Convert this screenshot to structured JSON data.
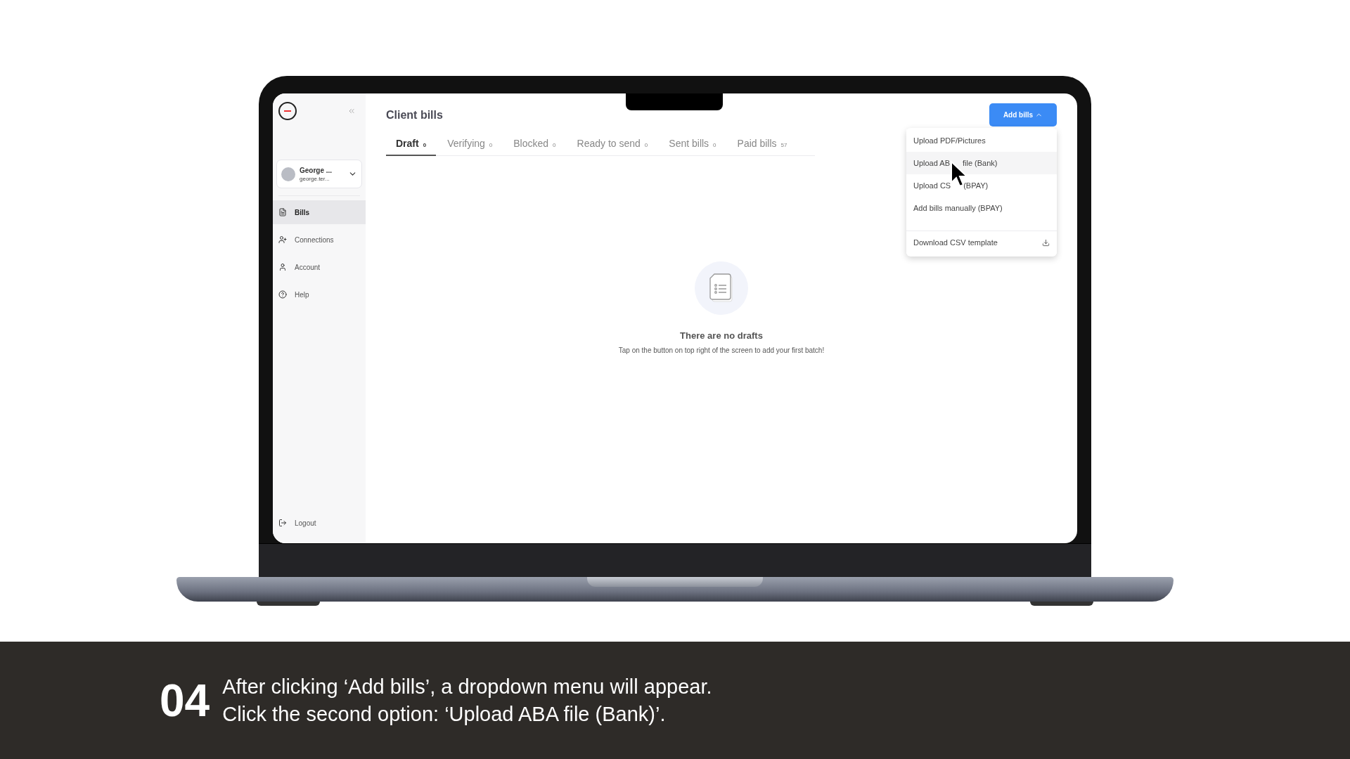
{
  "app": {
    "sidebar": {
      "user": {
        "name": "George ...",
        "email": "george.ter..."
      },
      "items": [
        {
          "label": "Bills",
          "selected": true
        },
        {
          "label": "Connections",
          "selected": false
        },
        {
          "label": "Account",
          "selected": false
        },
        {
          "label": "Help",
          "selected": false
        }
      ],
      "footer_item": {
        "label": "Logout"
      }
    },
    "header": {
      "title": "Client bills",
      "add_button": {
        "label": "Add bills",
        "expanded": true
      }
    },
    "tabs": [
      {
        "label": "Draft",
        "count": "0",
        "selected": true
      },
      {
        "label": "Verifying",
        "count": "0",
        "selected": false
      },
      {
        "label": "Blocked",
        "count": "0",
        "selected": false
      },
      {
        "label": "Ready to send",
        "count": "0",
        "selected": false
      },
      {
        "label": "Sent bills",
        "count": "0",
        "selected": false
      },
      {
        "label": "Paid bills",
        "count": "57",
        "selected": false
      }
    ],
    "menu": [
      {
        "kind": "option",
        "parts": [
          "Upload PDF/Pictures"
        ],
        "highlighted": false
      },
      {
        "kind": "option",
        "parts": [
          "Upload AB",
          "file (Bank)"
        ],
        "highlighted": true
      },
      {
        "kind": "option",
        "parts": [
          "Upload CS",
          "(BPAY)"
        ],
        "highlighted": false
      },
      {
        "kind": "option",
        "parts": [
          "Add bills manually (BPAY)"
        ],
        "highlighted": false
      },
      {
        "kind": "download",
        "parts": [
          "Download CSV template"
        ],
        "highlighted": false
      }
    ],
    "empty_state": {
      "title": "There are no drafts",
      "message": "Tap on the button on top right of the screen to add your first batch!"
    }
  },
  "caption": {
    "step": "04",
    "lines": [
      "After clicking ‘Add bills’, a dropdown menu will appear.",
      "Click the second option: ‘Upload ABA file (Bank)’."
    ]
  }
}
